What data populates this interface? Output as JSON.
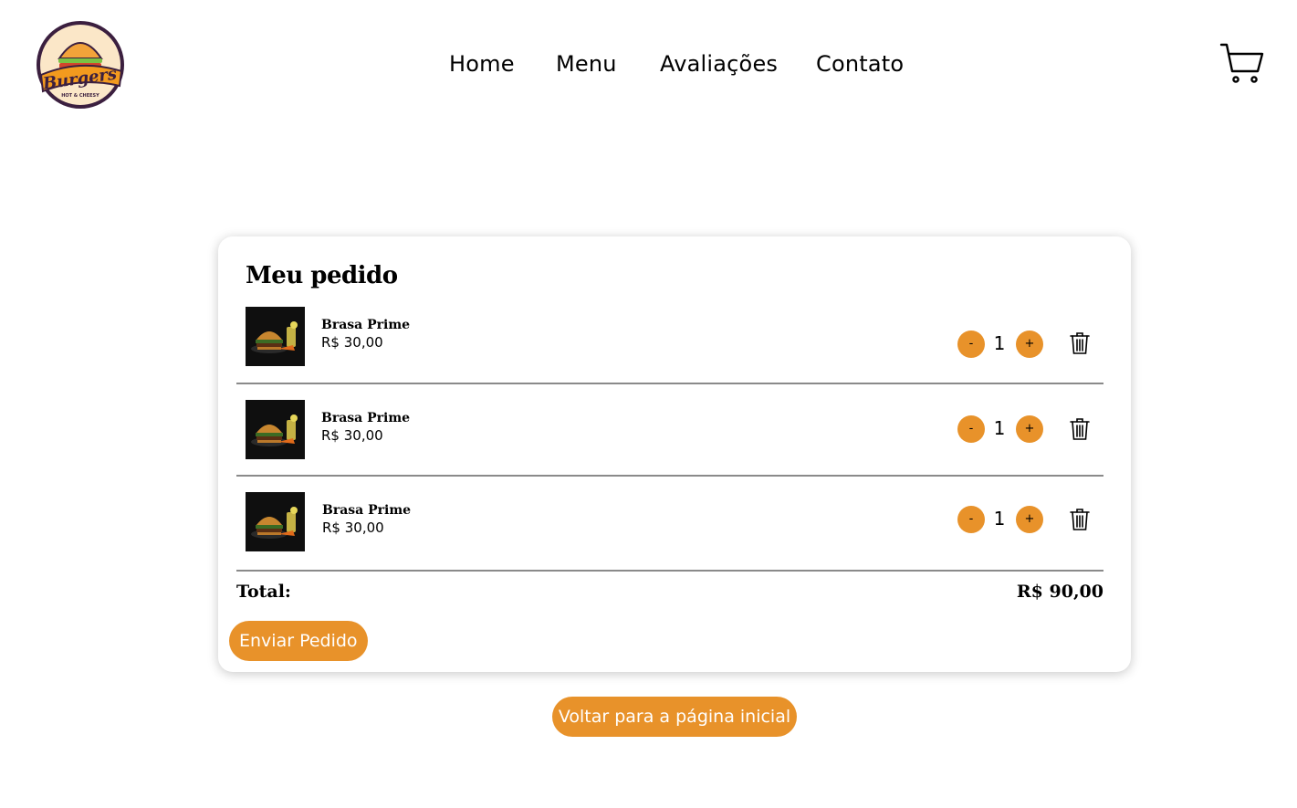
{
  "brand": {
    "logo_text": "Burgers",
    "logo_subtext": "HOT & CHEESY"
  },
  "nav": [
    {
      "label": "Home"
    },
    {
      "label": "Menu"
    },
    {
      "label": "Avaliações"
    },
    {
      "label": "Contato"
    }
  ],
  "header": {
    "cart_icon": "cart-icon"
  },
  "order": {
    "title": "Meu pedido",
    "items": [
      {
        "name": "Brasa Prime",
        "price": "R$ 30,00",
        "quantity": "1",
        "minus": "-",
        "plus": "+"
      },
      {
        "name": "Brasa Prime",
        "price": "R$ 30,00",
        "quantity": "1",
        "minus": "-",
        "plus": "+"
      },
      {
        "name": "Brasa Prime",
        "price": "R$ 30,00",
        "quantity": "1",
        "minus": "-",
        "plus": "+"
      }
    ],
    "total_label": "Total:",
    "total_value": "R$ 90,00",
    "send_label": "Enviar Pedido"
  },
  "back_label": "Voltar para a página inicial",
  "colors": {
    "accent": "#e8922a",
    "divider": "#8a8a8a",
    "logo_purple": "#3b1f3f",
    "logo_orange": "#f0a020"
  }
}
